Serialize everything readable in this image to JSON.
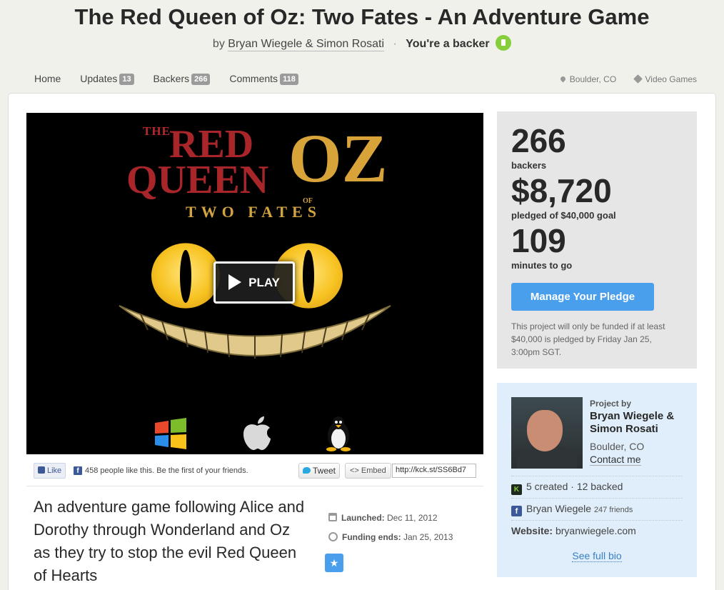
{
  "header": {
    "title": "The Red Queen of Oz: Two Fates - An Adventure Game",
    "by": "by",
    "creators": "Bryan Wiegele & Simon Rosati",
    "dot": "·",
    "backer_status": "You're a backer"
  },
  "nav": {
    "items": [
      {
        "label": "Home",
        "count": ""
      },
      {
        "label": "Updates",
        "count": "13"
      },
      {
        "label": "Backers",
        "count": "266"
      },
      {
        "label": "Comments",
        "count": "118"
      }
    ],
    "location": "Boulder, CO",
    "category": "Video Games"
  },
  "video": {
    "logo_the": "THE",
    "logo_red": "RED",
    "logo_queen": "QUEEN",
    "logo_of": "OF",
    "logo_oz": "OZ",
    "logo_subtitle": "TWO FATES",
    "play_label": "PLAY",
    "platforms": [
      "windows-icon",
      "apple-icon",
      "linux-icon"
    ]
  },
  "share": {
    "like_label": "Like",
    "like_text": "458 people like this. Be the first of your friends.",
    "tweet_label": "Tweet",
    "embed_label": "Embed",
    "short_url": "http://kck.st/SS6Bd7"
  },
  "blurb": "An adventure game following Alice and Dorothy through Wonderland and Oz as they try to stop the evil Red Queen of Hearts",
  "dates": {
    "launched_label": "Launched:",
    "launched_value": "Dec 11, 2012",
    "ends_label": "Funding ends:",
    "ends_value": "Jan 25, 2013"
  },
  "stats": {
    "backers_num": "266",
    "backers_label": "backers",
    "pledged_num": "$8,720",
    "pledged_label": "pledged of $40,000 goal",
    "time_num": "109",
    "time_label": "minutes to go",
    "manage_label": "Manage Your Pledge",
    "funding_note": "This project will only be funded if at least $40,000 is pledged by Friday Jan 25, 3:00pm SGT."
  },
  "creator": {
    "project_by": "Project by",
    "name": "Bryan Wiegele & Simon Rosati",
    "location": "Boulder, CO",
    "contact": "Contact me",
    "created": "5 created",
    "sep": "·",
    "backed": "12 backed",
    "fb_name": "Bryan Wiegele",
    "fb_friends": "247 friends",
    "website_label": "Website:",
    "website": "bryanwiegele.com",
    "see_bio": "See full bio"
  },
  "colors": {
    "accent_blue": "#4a9fec",
    "backer_green": "#86ce3c",
    "facebook_blue": "#3b5998"
  }
}
